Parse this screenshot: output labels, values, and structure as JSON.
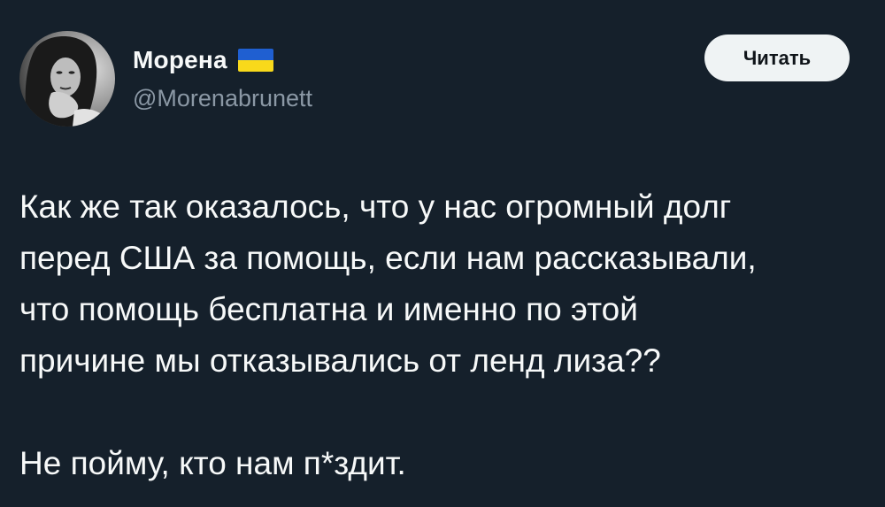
{
  "tweet": {
    "author": {
      "display_name": "Морена",
      "handle": "@Morenabrunett",
      "flag_icon": "ukraine-flag-icon",
      "flag_colors": [
        "#1f5fd1",
        "#f8d91b"
      ]
    },
    "follow_button": {
      "label": "Читать"
    },
    "body": {
      "lines": [
        "Как же так оказалось, что у нас огромный долг",
        "перед США за помощь, если нам рассказывали,",
        "что помощь бесплатна и именно по этой",
        "причине мы отказывались от ленд лиза??"
      ],
      "closing": "Не пойму, кто нам п*здит."
    }
  },
  "colors": {
    "background": "#15202b",
    "text_primary": "#f7f9f9",
    "text_secondary": "#8b98a5",
    "button_bg": "#eff3f4"
  }
}
